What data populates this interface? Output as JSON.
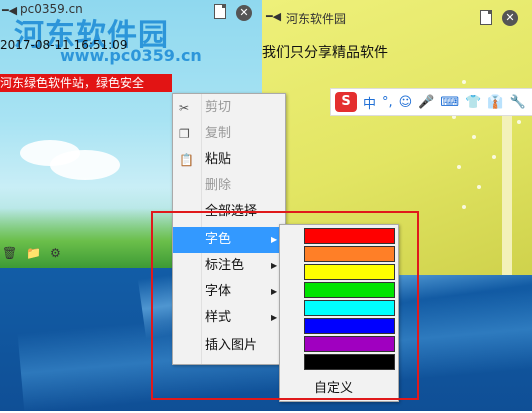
{
  "watermark": {
    "logo": "河东软件园",
    "url": "www.pc0359.cn"
  },
  "left_note": {
    "site": "pc0359.cn",
    "datetime": "2017-08-11 16:51:09",
    "highlighted_text": "河东绿色软件站，绿色安全",
    "icons": [
      "pin-icon",
      "doc-icon",
      "close-icon",
      "trash-icon",
      "folder-icon",
      "gear-icon"
    ]
  },
  "right_note": {
    "title": "河东软件园",
    "text": "我们只分享精品软件"
  },
  "ime_toolbar": {
    "items": [
      "S",
      "中",
      "°,",
      "☺",
      "🎤",
      "⌨",
      "👕",
      "👔",
      "🔧"
    ]
  },
  "context_menu": {
    "items": [
      {
        "label": "剪切",
        "icon": "cut-icon",
        "disabled": true
      },
      {
        "label": "复制",
        "icon": "copy-icon",
        "disabled": true
      },
      {
        "label": "粘贴",
        "icon": "paste-icon",
        "disabled": false
      },
      {
        "label": "删除",
        "icon": "",
        "disabled": true
      },
      {
        "label": "全部选择",
        "icon": "",
        "disabled": false
      },
      {
        "label": "字色",
        "icon": "",
        "disabled": false,
        "submenu": true,
        "active": true
      },
      {
        "label": "标注色",
        "icon": "",
        "disabled": false,
        "submenu": true
      },
      {
        "label": "字体",
        "icon": "",
        "disabled": false,
        "submenu": true
      },
      {
        "label": "样式",
        "icon": "",
        "disabled": false,
        "submenu": true
      },
      {
        "label": "插入图片",
        "icon": "",
        "disabled": false
      }
    ]
  },
  "color_submenu": {
    "swatches": [
      "#ff0000",
      "#ff7f27",
      "#ffff00",
      "#00e400",
      "#00ffff",
      "#0000ff",
      "#a000c0",
      "#000000"
    ],
    "custom_label": "自定义"
  }
}
